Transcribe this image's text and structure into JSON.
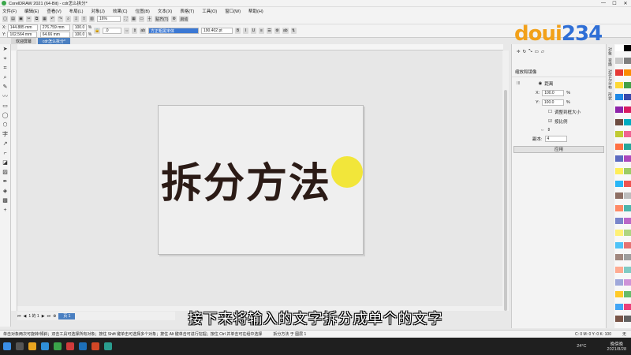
{
  "window": {
    "title": "CorelDRAW 2021 (64-Bit) - cdr怎么拆分*",
    "controls": [
      "—",
      "☐",
      "✕"
    ]
  },
  "menu": {
    "items": [
      "文件(F)",
      "编辑(E)",
      "查看(V)",
      "布局(L)",
      "对象(J)",
      "效果(C)",
      "位图(B)",
      "文本(X)",
      "表格(T)",
      "工具(O)",
      "窗口(W)",
      "帮助(H)"
    ]
  },
  "toolbar1": {
    "zoom": "16%",
    "snap_label": "贴齐(T)",
    "launch_label": "启动"
  },
  "toolbar2": {
    "x": "144.885 mm",
    "y": "102.564 mm",
    "w": "276.759 mm",
    "h": "64.66 mm",
    "scale_w": "100.0",
    "scale_h": "100.0",
    "pct": "%",
    "rotation": ".0",
    "font": "方正粗黑宋体",
    "font_size": "190.402 pt"
  },
  "tabs": [
    {
      "label": "欢迎屏幕"
    },
    {
      "label": "cdr怎么拆分*"
    }
  ],
  "canvas": {
    "main_text": "拆分方法"
  },
  "pagebar": {
    "page_count": "1 的 1",
    "page_label": "页 1"
  },
  "docker": {
    "title": "缩放和镜像",
    "mode_label": "距离",
    "x_label": "X:",
    "x_value": "100.0",
    "y_label": "Y:",
    "y_value": "100.0",
    "pct": "%",
    "option1": "调整到框大小",
    "option2": "按比例",
    "copies_label": "副本:",
    "copies_value": "4",
    "apply_label": "应用"
  },
  "sidetabs": [
    "对象",
    "变换",
    "对齐与分布",
    "形状"
  ],
  "status": {
    "hint": "单击对象两次可旋转/倾斜；双击工具可选择所有对象；按住 Shift 键单击可选择多个对象；按住 Alt 键单击可进行挖掘；按住 Ctrl 并单击可在组中选择",
    "layer": "拆分方法 于 图层 1",
    "fill": "C: 0 M: 0 Y: 0 K: 100",
    "outline": "无"
  },
  "subtitle": "接下来将输入的文字拆分成单个的文字",
  "brand": {
    "part1": "doui",
    "part2": "234"
  },
  "taskbar": {
    "weather": "24°C",
    "time": "晚傍晚",
    "date": "2021/8/28"
  },
  "colors": {
    "accent": "#4a7fc1",
    "text_dark": "#2b1b16",
    "highlight": "#f2e41a"
  }
}
